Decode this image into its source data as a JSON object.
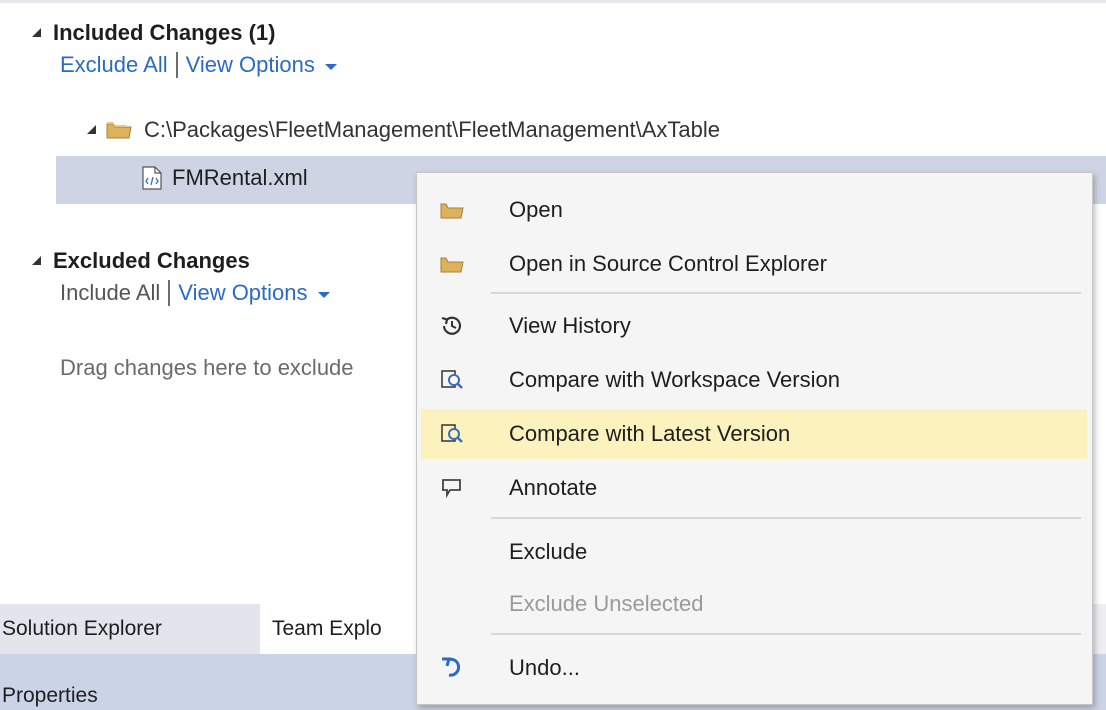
{
  "included": {
    "header": "Included Changes (1)",
    "exclude_all": "Exclude All",
    "view_options": "View Options",
    "folder_path": "C:\\Packages\\FleetManagement\\FleetManagement\\AxTable",
    "file_name": "FMRental.xml"
  },
  "excluded": {
    "header": "Excluded Changes",
    "include_all": "Include All",
    "view_options": "View Options",
    "hint": "Drag changes here to exclude"
  },
  "tabs": {
    "solution_explorer": "Solution Explorer",
    "team_explorer": "Team Explo"
  },
  "properties": {
    "title": "Properties"
  },
  "context_menu": {
    "open": "Open",
    "open_scc": "Open in Source Control Explorer",
    "view_history": "View History",
    "compare_workspace": "Compare with Workspace Version",
    "compare_latest": "Compare with Latest Version",
    "annotate": "Annotate",
    "exclude": "Exclude",
    "exclude_unselected": "Exclude Unselected",
    "undo": "Undo..."
  },
  "colors": {
    "link": "#2a6ac8",
    "selection_row": "#cfd4e4",
    "menu_highlight": "#fcf2bd"
  }
}
